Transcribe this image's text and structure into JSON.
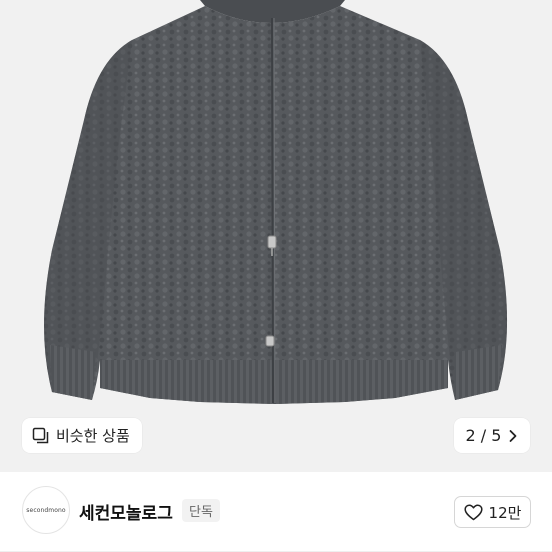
{
  "gallery": {
    "similar_label": "비슷한 상품",
    "pager_text": "2 / 5"
  },
  "seller": {
    "avatar_text": "secondmono",
    "name": "세컨모놀로그",
    "badge": "단독",
    "like_count": "12만"
  },
  "colors": {
    "sweater": "#55585c",
    "background": "#f1f1f1"
  },
  "icons": {
    "similar": "similar-items-icon",
    "pager_next": "chevron-right-icon",
    "like": "heart-icon"
  }
}
